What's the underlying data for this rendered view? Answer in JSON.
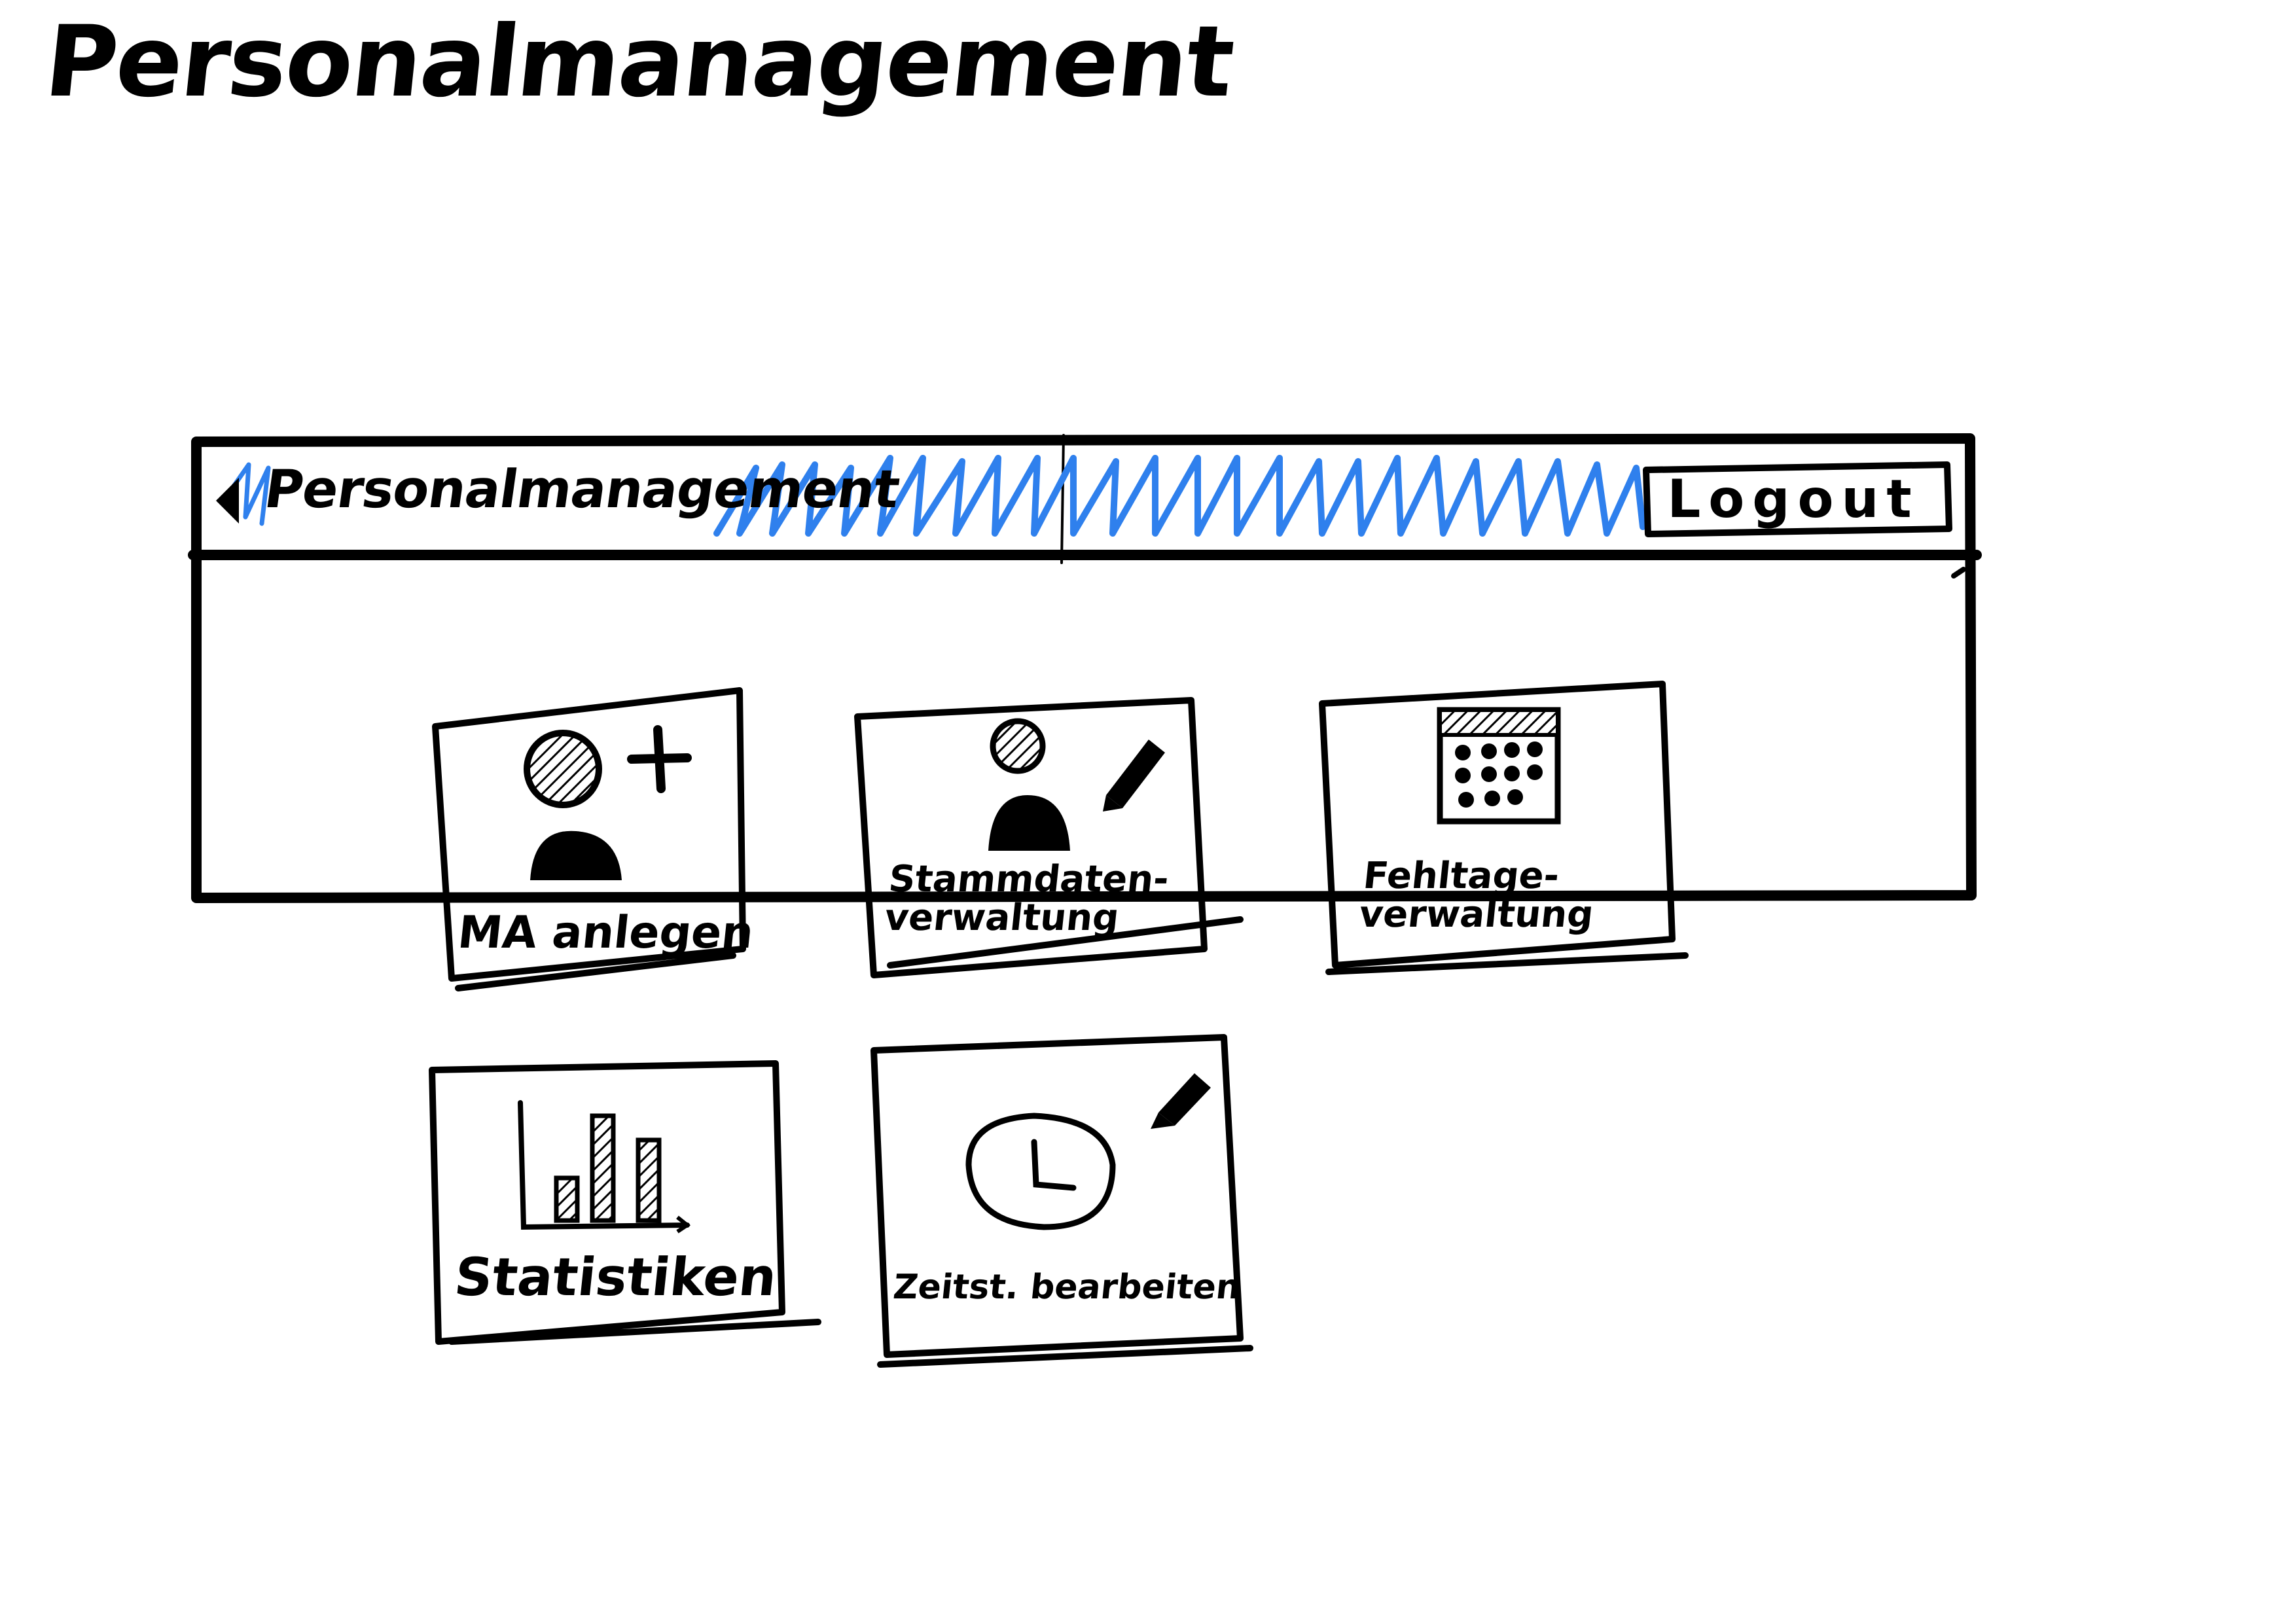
{
  "sketch_title": "Personalmanagement",
  "header": {
    "app_title": "Personalmanagement",
    "logout_label": "Logout",
    "accent_color": "#2f80ed"
  },
  "tiles": [
    {
      "label": "MA anlegen",
      "icon": "add-user-icon"
    },
    {
      "label": "Stammdaten-\nverwaltung",
      "icon": "edit-user-icon"
    },
    {
      "label": "Fehltage-\nverwaltung",
      "icon": "calendar-icon"
    },
    {
      "label": "Statistiken",
      "icon": "bar-chart-icon"
    },
    {
      "label": "Zeitst. bearbeiten",
      "icon": "edit-clock-icon"
    }
  ]
}
